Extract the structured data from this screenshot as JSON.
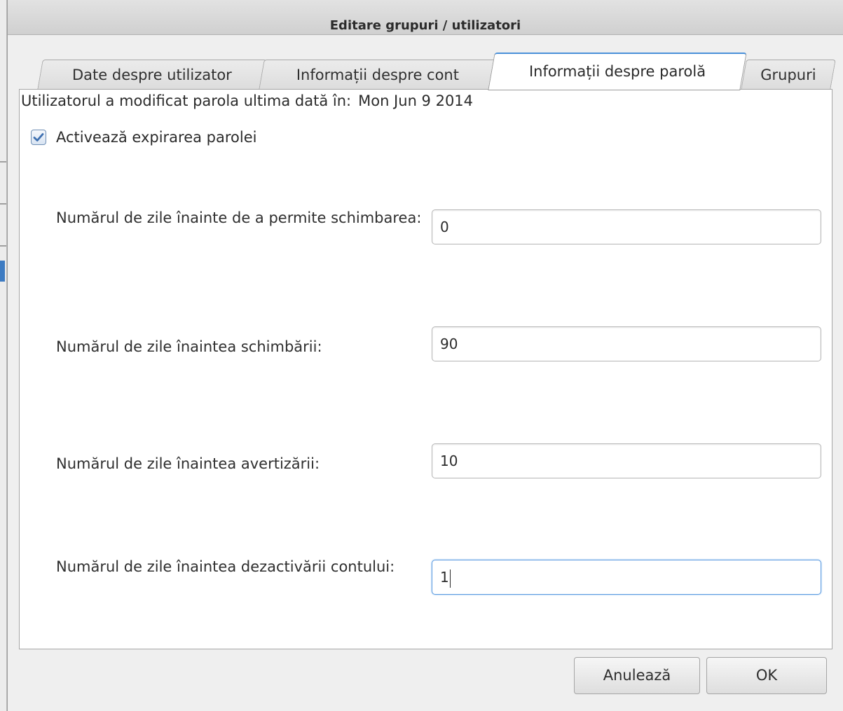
{
  "window": {
    "title": "Editare grupuri / utilizatori"
  },
  "tabs": [
    {
      "label": "Date despre utilizator",
      "active": false
    },
    {
      "label": "Informații despre cont",
      "active": false
    },
    {
      "label": "Informații despre parolă",
      "active": true
    },
    {
      "label": "Grupuri",
      "active": false
    }
  ],
  "password_info": {
    "last_changed_label": "Utilizatorul a modificat parola ultima dată în:",
    "last_changed_value": "Mon Jun 9 2014",
    "expiration_checkbox_label": "Activează expirarea parolei",
    "expiration_checked": true,
    "fields": [
      {
        "label": "Numărul de zile înainte de a permite schimbarea:",
        "value": "0"
      },
      {
        "label": "Numărul de zile înaintea schimbării:",
        "value": "90"
      },
      {
        "label": "Numărul de zile înaintea avertizării:",
        "value": "10"
      },
      {
        "label": "Numărul de zile înaintea dezactivării contului:",
        "value": "1"
      }
    ]
  },
  "buttons": {
    "cancel_label": "Anulează",
    "ok_label": "OK"
  },
  "colors": {
    "accent": "#4a90d9",
    "check": "#3d6fb0"
  },
  "icons": {
    "checkbox": "checkmark-icon"
  }
}
